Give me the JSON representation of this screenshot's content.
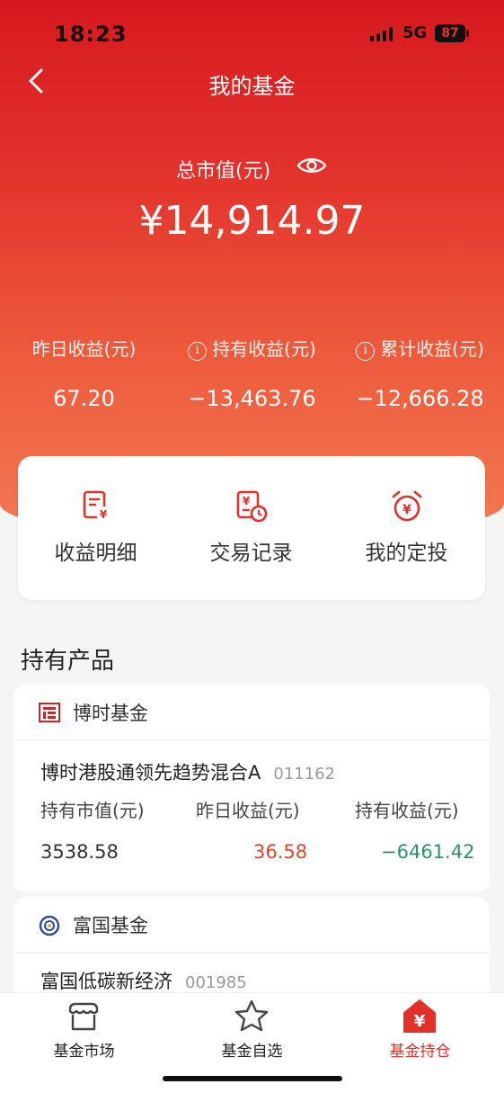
{
  "status": {
    "time": "18:23",
    "network": "5G",
    "battery": "87"
  },
  "header": {
    "title": "我的基金"
  },
  "summary": {
    "total_label": "总市值(元)",
    "total_value": "¥14,914.97",
    "stats": [
      {
        "label": "昨日收益(元)",
        "value": "67.20"
      },
      {
        "label": "持有收益(元)",
        "value": "−13,463.76"
      },
      {
        "label": "累计收益(元)",
        "value": "−12,666.28"
      }
    ]
  },
  "quick_actions": [
    {
      "label": "收益明细",
      "icon": "income-detail-icon"
    },
    {
      "label": "交易记录",
      "icon": "transaction-record-icon"
    },
    {
      "label": "我的定投",
      "icon": "alarm-clock-yen-icon"
    }
  ],
  "holdings": {
    "title": "持有产品",
    "columns": [
      "持有市值(元)",
      "昨日收益(元)",
      "持有收益(元)"
    ],
    "funds": [
      {
        "company": "博时基金",
        "name": "博时港股通领先趋势混合A",
        "code": "011162",
        "market_value": "3538.58",
        "yesterday": "36.58",
        "holding": "−6461.42"
      },
      {
        "company": "富国基金",
        "name": "富国低碳新经济",
        "code": "001985"
      }
    ]
  },
  "tabbar": [
    {
      "label": "基金市场",
      "icon": "market-stall-icon"
    },
    {
      "label": "基金自选",
      "icon": "star-icon"
    },
    {
      "label": "基金持仓",
      "icon": "yen-house-icon"
    }
  ],
  "colors": {
    "brand_red": "#e2302b",
    "gain": "#e2452b",
    "loss": "#2f8f6e"
  }
}
